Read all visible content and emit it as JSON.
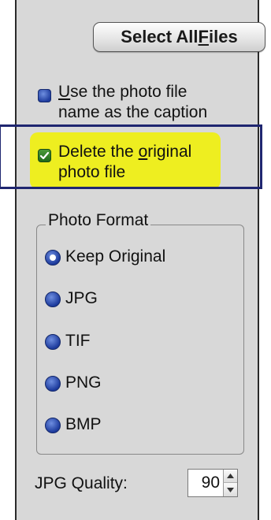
{
  "buttons": {
    "select_all_pre": "Select All ",
    "select_all_key": "F",
    "select_all_post": "iles"
  },
  "options": {
    "caption_pre": "",
    "caption_key": "U",
    "caption_line1_post": "se the photo file",
    "caption_line2": "name as the caption",
    "caption_checked": false,
    "delete_line1_pre": "Delete the ",
    "delete_key": "o",
    "delete_line1_post": "riginal",
    "delete_line2": "photo file",
    "delete_checked": true
  },
  "photo_format": {
    "title": "Photo Format",
    "selected": "Keep Original",
    "items": [
      {
        "label": "Keep Original"
      },
      {
        "label": "JPG"
      },
      {
        "label": "TIF"
      },
      {
        "label": "PNG"
      },
      {
        "label": "BMP"
      }
    ]
  },
  "jpg_quality": {
    "label": "JPG Quality:",
    "value": "90"
  },
  "colors": {
    "panel": "#d8d8d8",
    "highlight": "#f2f200",
    "focus_border": "#1f2670",
    "radio_blue": "#1c3a9c"
  }
}
